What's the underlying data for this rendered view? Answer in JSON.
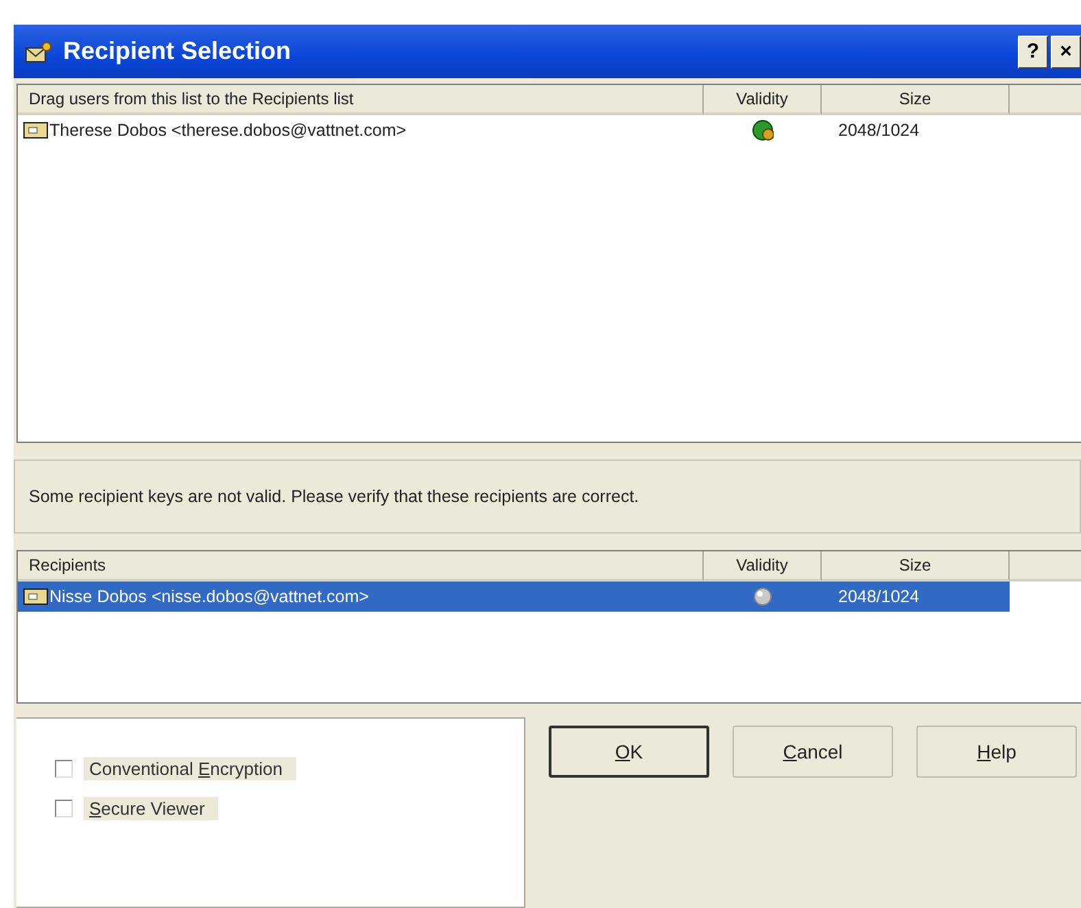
{
  "window": {
    "title": "Recipient Selection",
    "buttons": [
      "?",
      "×"
    ]
  },
  "user_list": {
    "columns": [
      "Drag users from this list to the Recipients list",
      "Validity",
      "Size"
    ],
    "rows": [
      {
        "name": "Therese Dobos <therese.dobos@vattnet.com>",
        "kind": "valid",
        "size": "2048/1024",
        "selected": false
      }
    ]
  },
  "message": "Some recipient keys are not valid. Please verify that these recipients are correct.",
  "recipient_list": {
    "columns": [
      "Recipients",
      "Validity",
      "Size"
    ],
    "rows": [
      {
        "name": "Nisse Dobos <nisse.dobos@vattnet.com>",
        "kind": "unknown",
        "size": "2048/1024",
        "selected": true
      }
    ]
  },
  "options": [
    {
      "label": {
        "before": "Conventional ",
        "key": "E",
        "after": "ncryption"
      },
      "checked": false
    },
    {
      "label": {
        "key": "S",
        "after": "ecure Viewer"
      },
      "checked": false
    }
  ],
  "buttons": [
    {
      "label": {
        "key": "O",
        "after": "K"
      },
      "default": true
    },
    {
      "label": {
        "key": "C",
        "after": "ancel"
      },
      "default": false
    },
    {
      "label": {
        "key": "H",
        "after": "elp"
      },
      "default": false
    }
  ]
}
